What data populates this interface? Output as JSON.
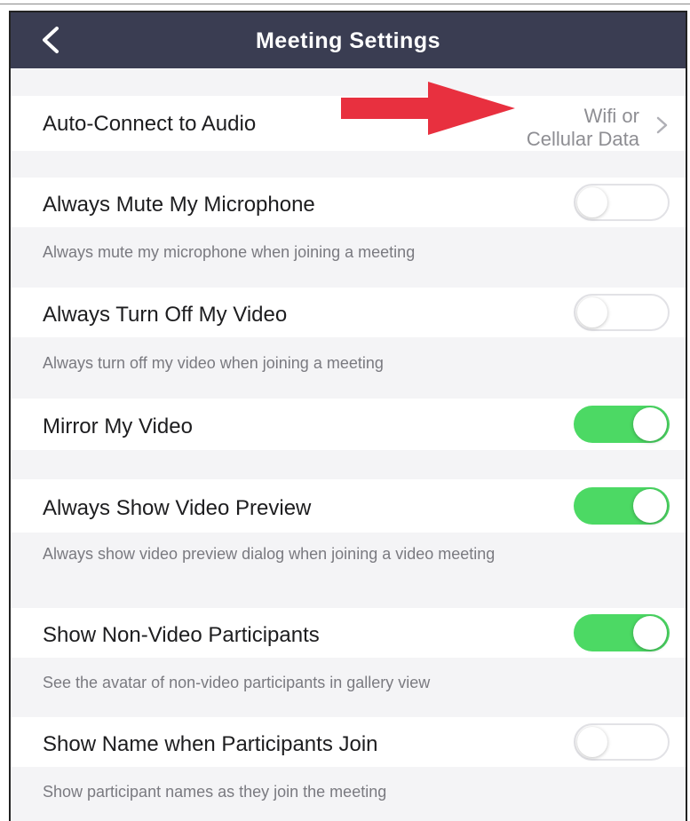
{
  "header": {
    "title": "Meeting Settings"
  },
  "audio": {
    "label": "Auto-Connect to Audio",
    "value_line1": "Wifi or",
    "value_line2": "Cellular Data"
  },
  "settings": [
    {
      "label": "Always Mute My Microphone",
      "description": "Always mute my microphone when joining a meeting",
      "enabled": false
    },
    {
      "label": "Always Turn Off My Video",
      "description": "Always turn off my video when joining a meeting",
      "enabled": false
    },
    {
      "label": "Mirror My Video",
      "description": "",
      "enabled": true
    },
    {
      "label": "Always Show Video Preview",
      "description": "Always show video preview dialog when joining a video meeting",
      "enabled": true
    },
    {
      "label": "Show Non-Video Participants",
      "description": "See the avatar of non-video participants in gallery view",
      "enabled": true
    },
    {
      "label": "Show Name when Participants Join",
      "description": "Show participant names as they join the meeting",
      "enabled": false
    }
  ],
  "colors": {
    "nav": "#3a3d52",
    "toggle_on": "#4cd964",
    "annotation_arrow": "#e8303f"
  },
  "icons": {
    "back": "chevron-left-icon",
    "disclosure": "chevron-right-icon",
    "annotation": "red-arrow"
  }
}
